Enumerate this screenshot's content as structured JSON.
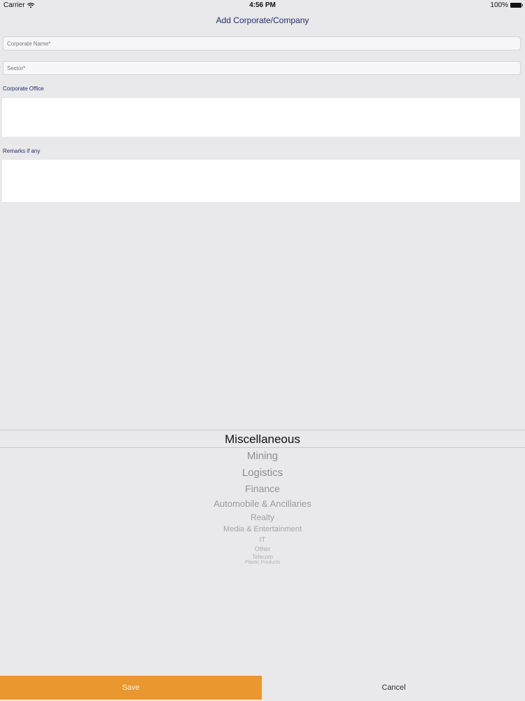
{
  "status": {
    "carrier": "Carrier",
    "time": "4:56 PM",
    "battery": "100%"
  },
  "header": {
    "title": "Add Corporate/Company"
  },
  "form": {
    "corporate_name_placeholder": "Corporate Name*",
    "sector_placeholder": "Sector*",
    "corporate_office_label": "Corporate Office",
    "remarks_label": "Remarks if any"
  },
  "picker": {
    "selected": "Miscellaneous",
    "options": [
      "Mining",
      "Logistics",
      "Finance",
      "Automobile & Ancillaries",
      "Realty",
      "Media & Entertainment",
      "IT",
      "Other",
      "Telecom",
      "Plastic Products"
    ]
  },
  "footer": {
    "save_label": "Save",
    "cancel_label": "Cancel"
  }
}
